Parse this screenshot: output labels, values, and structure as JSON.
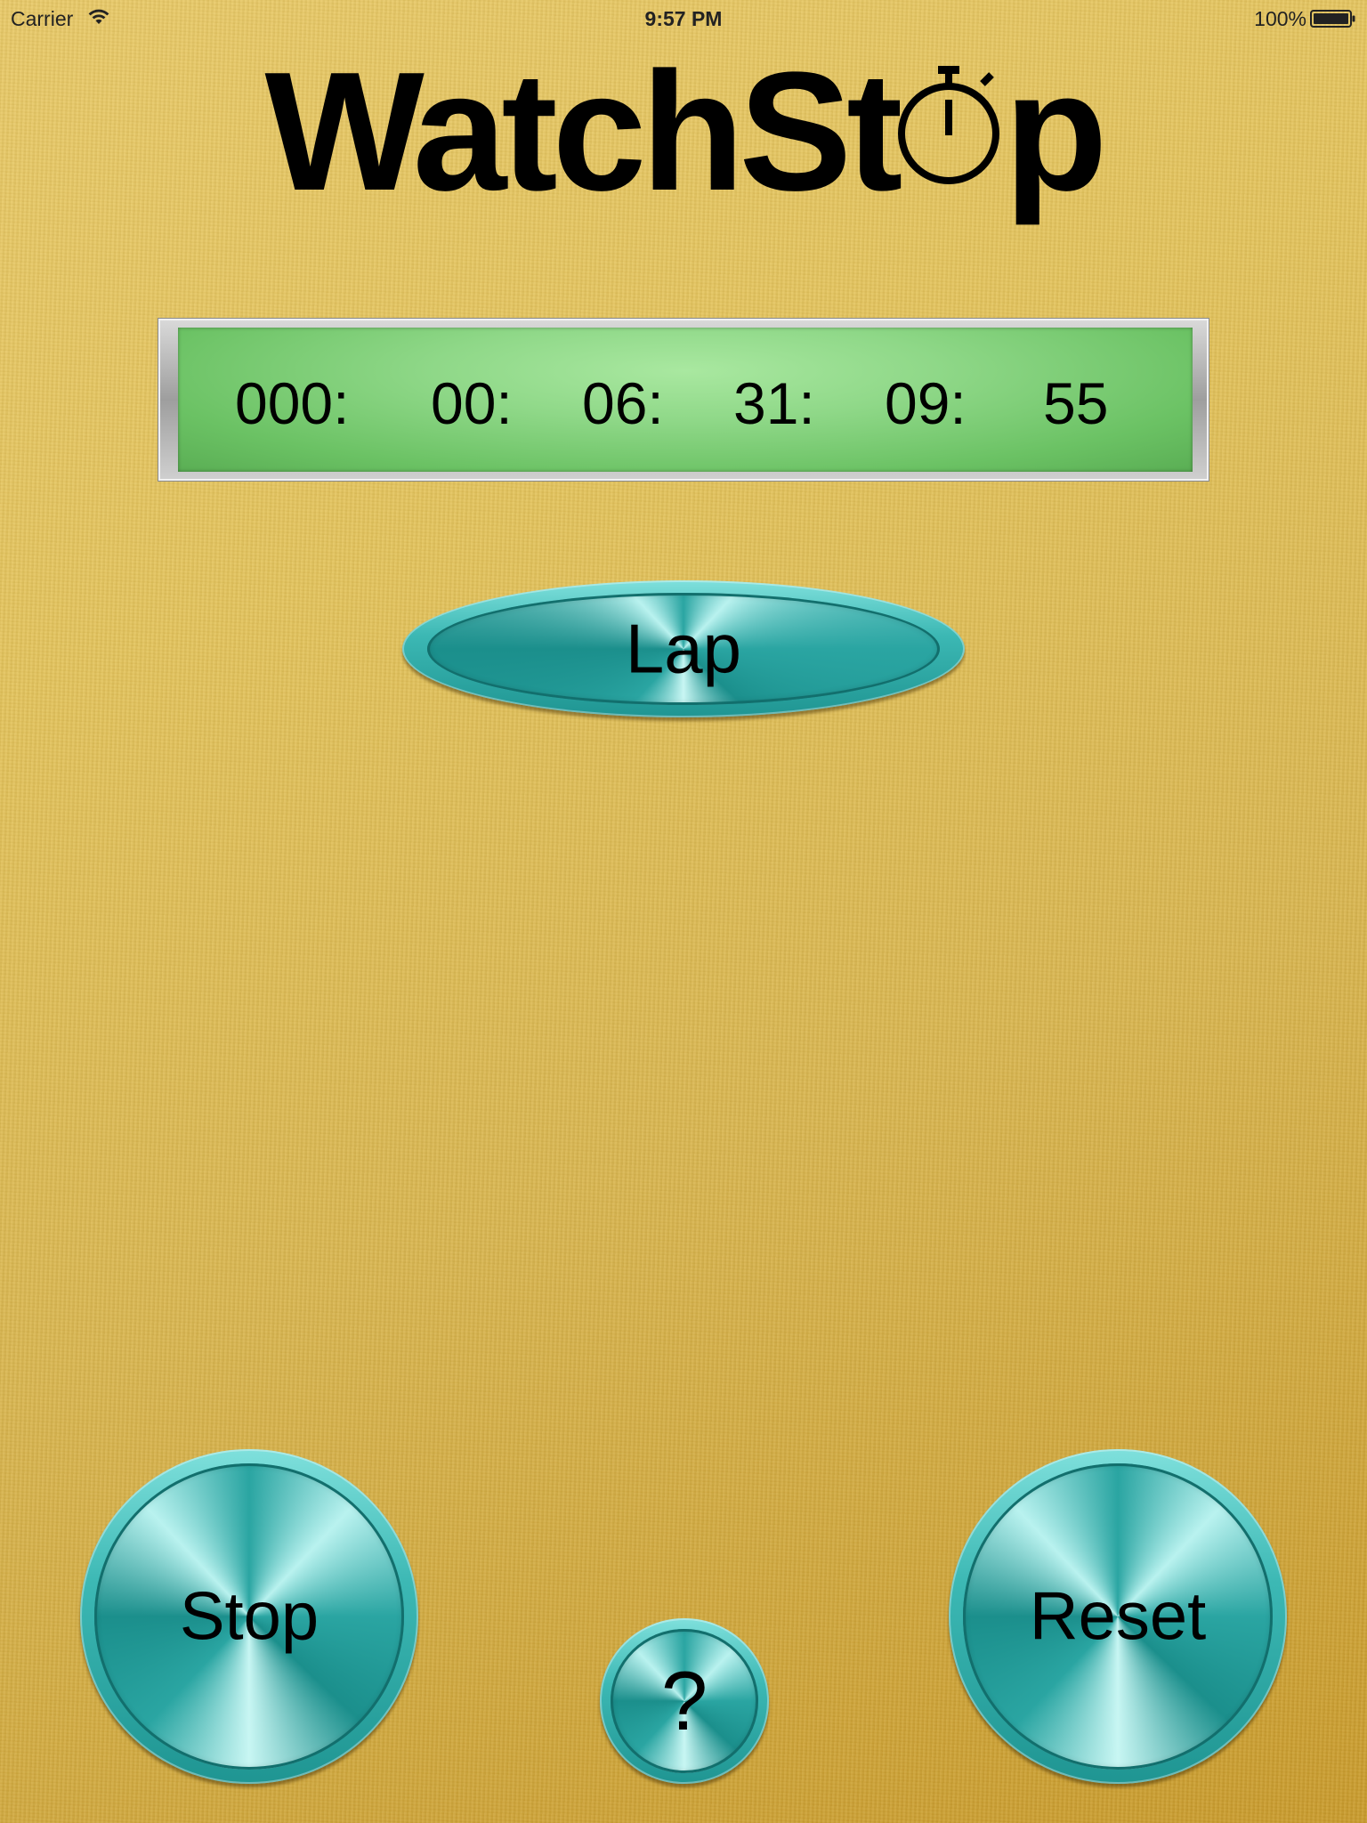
{
  "status_bar": {
    "carrier": "Carrier",
    "time": "9:57 PM",
    "battery": "100%"
  },
  "logo": {
    "text_before": "WatchSt",
    "text_after": "p"
  },
  "display": {
    "segments": [
      "000:",
      "00:",
      "06:",
      "31:",
      "09:",
      "55"
    ]
  },
  "buttons": {
    "lap": "Lap",
    "stop": "Stop",
    "reset": "Reset",
    "help": "?"
  },
  "icons": {
    "wifi": "wifi-icon",
    "battery": "battery-icon",
    "logo_o": "stopwatch-icon"
  },
  "colors": {
    "background": "#e3c35c",
    "display_green": "#8fd888",
    "button_teal": "#2aa5a2"
  }
}
